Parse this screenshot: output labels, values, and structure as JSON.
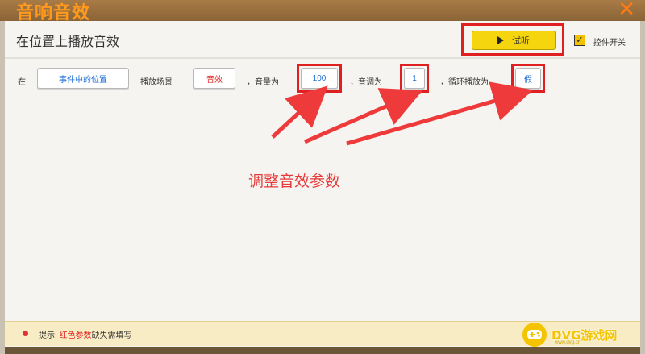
{
  "window": {
    "title": "音响音效",
    "close_glyph": "✕"
  },
  "panel": {
    "title": "在位置上播放音效"
  },
  "tryout_button": {
    "label": "试听"
  },
  "toggle": {
    "label": "控件开关",
    "checked": true,
    "check_glyph": "✓"
  },
  "row": {
    "text_at": "在",
    "chip_location": "事件中的位置",
    "text_scene": "播放场景",
    "chip_sound": "音效",
    "text_volume": "，音量为",
    "volume_value": "100",
    "text_pitch": "，音调为",
    "pitch_value": "1",
    "text_loop": "，循环播放为",
    "loop_value": "假"
  },
  "annotation": "调整音效参数",
  "footer": {
    "prefix": "提示:",
    "highlight": "红色参数",
    "suffix": "缺失需填写"
  },
  "watermark": {
    "text": "DVG游戏网",
    "sub": "www.dvg.cn"
  },
  "colors": {
    "accent_red": "#e02020",
    "button_yellow": "#f5d60e",
    "title_orange": "#ff9a1f",
    "chip_blue": "#1f6fd6"
  },
  "icons": [
    "close-icon",
    "play-icon",
    "checkbox-icon",
    "hint-dot-icon",
    "gamepad-icon"
  ]
}
